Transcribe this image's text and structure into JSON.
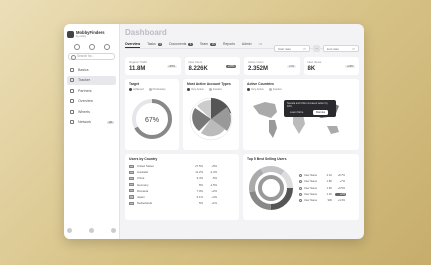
{
  "app": {
    "name": "MobbyFinders",
    "sub": "by cosby"
  },
  "search_placeholder": "Search for...",
  "nav": [
    {
      "label": "Basics",
      "active": false
    },
    {
      "label": "Tracker",
      "active": true
    },
    {
      "label": "Partners",
      "active": false
    },
    {
      "label": "Overview",
      "active": false
    },
    {
      "label": "Wheels",
      "active": false
    },
    {
      "label": "Network",
      "active": false,
      "badge": "20"
    }
  ],
  "page_title": "Dashboard",
  "tabs": [
    {
      "label": "Overview",
      "active": true
    },
    {
      "label": "Tasks",
      "badge": "4"
    },
    {
      "label": "Documents",
      "badge": "6"
    },
    {
      "label": "Team",
      "badge": "16"
    },
    {
      "label": "Reports"
    },
    {
      "label": "Admin"
    }
  ],
  "tabs_more": "•••",
  "filters": {
    "start": "Start date",
    "end": "End date"
  },
  "kpis": [
    {
      "label": "Organic Traffic",
      "value": "11.8M",
      "delta": "+35%",
      "dark": false
    },
    {
      "label": "New Users",
      "value": "8.226K",
      "delta": "+37%",
      "dark": true
    },
    {
      "label": "Active Users",
      "value": "2.352M",
      "delta": "+1%",
      "dark": false
    },
    {
      "label": "New Views",
      "value": "8K",
      "delta": "+22%",
      "dark": false
    }
  ],
  "target": {
    "title": "Target",
    "legend": [
      "Achieved",
      "Preliminary"
    ],
    "value": "67%",
    "fraction": 0.67
  },
  "account_types": {
    "title": "Most Active Account Types",
    "legend": [
      "Very Active",
      "Inactive"
    ]
  },
  "countries": {
    "title": "Active Countries",
    "legend": [
      "Very Active",
      "Inactive"
    ],
    "tooltip": {
      "text": "Nevada and Chile increased sellers by 40%",
      "btn1": "Learn More",
      "btn2": "Dismiss"
    }
  },
  "users_by_country": {
    "title": "Users by Country",
    "rows": [
      {
        "country": "United States",
        "value": "27.5%",
        "change": "+5%"
      },
      {
        "country": "Australia",
        "value": "11.2%",
        "change": "-2.4%"
      },
      {
        "country": "China",
        "value": "9.4%",
        "change": "-5%"
      },
      {
        "country": "Germany",
        "value": "8%",
        "change": "-1.5%"
      },
      {
        "country": "Romania",
        "value": "7.9%",
        "change": "+2%"
      },
      {
        "country": "Japan",
        "value": "6.1%",
        "change": "+4%"
      },
      {
        "country": "Netherlands",
        "value": "5%",
        "change": "+1%"
      }
    ]
  },
  "top_users": {
    "title": "Top 5 Best Selling Users",
    "rows": [
      {
        "name": "User Name",
        "value": "2.1K",
        "change": "+8.7%",
        "hl": false
      },
      {
        "name": "User Name",
        "value": "1.8K",
        "change": "+7%",
        "hl": false
      },
      {
        "name": "User Name",
        "value": "1.5K",
        "change": "+6.5%",
        "hl": false
      },
      {
        "name": "User Name",
        "value": "1.2K",
        "change": "+2%",
        "hl": true
      },
      {
        "name": "User Name",
        "value": "900",
        "change": "+4.4%",
        "hl": false
      }
    ]
  }
}
